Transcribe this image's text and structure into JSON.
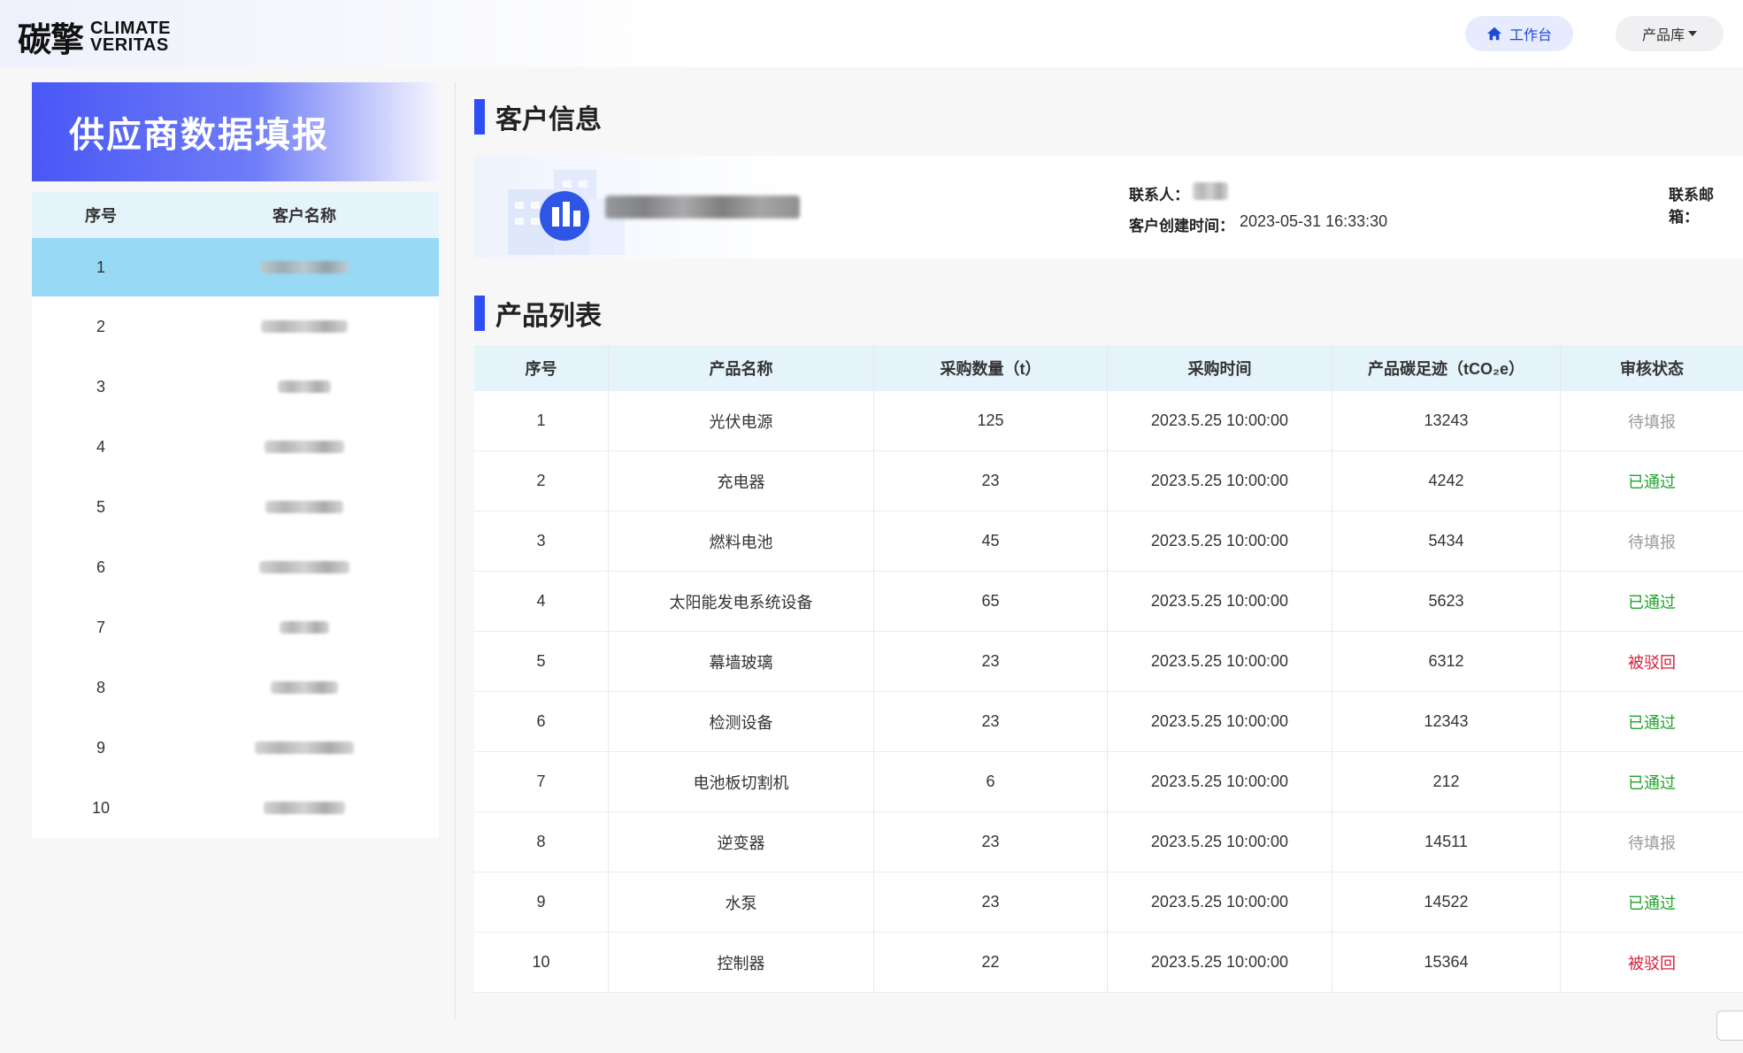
{
  "header": {
    "logo_cn": "碳擎",
    "logo_en_line1": "CLIMATE",
    "logo_en_line2": "VERITAS",
    "workbench_label": "工作台",
    "library_label": "产品库"
  },
  "sidebar": {
    "banner_title": "供应商数据填报",
    "columns": [
      "序号",
      "客户名称"
    ],
    "rows": [
      "1",
      "2",
      "3",
      "4",
      "5",
      "6",
      "7",
      "8",
      "9",
      "10"
    ],
    "selected_index": 0
  },
  "customer_info": {
    "section_title": "客户信息",
    "contact_label": "联系人：",
    "email_label": "联系邮箱：",
    "created_label": "客户创建时间：",
    "created_value": "2023-05-31 16:33:30"
  },
  "product_list": {
    "section_title": "产品列表",
    "columns": [
      "序号",
      "产品名称",
      "采购数量（t）",
      "采购时间",
      "产品碳足迹（tCO₂e）",
      "审核状态"
    ],
    "rows": [
      {
        "no": "1",
        "name": "光伏电源",
        "qty": "125",
        "time": "2023.5.25  10:00:00",
        "carbon": "13243",
        "status": "待填报"
      },
      {
        "no": "2",
        "name": "充电器",
        "qty": "23",
        "time": "2023.5.25  10:00:00",
        "carbon": "4242",
        "status": "已通过"
      },
      {
        "no": "3",
        "name": "燃料电池",
        "qty": "45",
        "time": "2023.5.25  10:00:00",
        "carbon": "5434",
        "status": "待填报"
      },
      {
        "no": "4",
        "name": "太阳能发电系统设备",
        "qty": "65",
        "time": "2023.5.25  10:00:00",
        "carbon": "5623",
        "status": "已通过"
      },
      {
        "no": "5",
        "name": "幕墙玻璃",
        "qty": "23",
        "time": "2023.5.25  10:00:00",
        "carbon": "6312",
        "status": "被驳回"
      },
      {
        "no": "6",
        "name": "检测设备",
        "qty": "23",
        "time": "2023.5.25  10:00:00",
        "carbon": "12343",
        "status": "已通过"
      },
      {
        "no": "7",
        "name": "电池板切割机",
        "qty": "6",
        "time": "2023.5.25  10:00:00",
        "carbon": "212",
        "status": "已通过"
      },
      {
        "no": "8",
        "name": "逆变器",
        "qty": "23",
        "time": "2023.5.25  10:00:00",
        "carbon": "14511",
        "status": "待填报"
      },
      {
        "no": "9",
        "name": "水泵",
        "qty": "23",
        "time": "2023.5.25  10:00:00",
        "carbon": "14522",
        "status": "已通过"
      },
      {
        "no": "10",
        "name": "控制器",
        "qty": "22",
        "time": "2023.5.25  10:00:00",
        "carbon": "15364",
        "status": "被驳回"
      }
    ]
  },
  "status_colors": {
    "待填报": "#9a9a9a",
    "已通过": "#1fa32b",
    "被驳回": "#d8203a"
  },
  "icons": {
    "workbench": "home-icon",
    "library": "caret-down-icon",
    "customer": "building-icon"
  }
}
